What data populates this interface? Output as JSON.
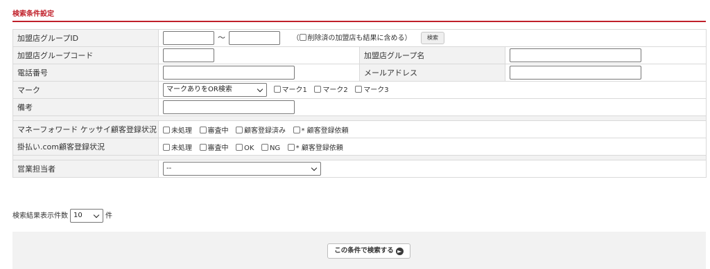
{
  "section_title": "検索条件設定",
  "rows": {
    "group_id": {
      "label": "加盟店グループID",
      "tilde": "～",
      "include_deleted": "削除済の加盟店も結果に含める",
      "paren_open": "（",
      "paren_close": "）",
      "search_button": "検索"
    },
    "group_code": {
      "label": "加盟店グループコード"
    },
    "group_name": {
      "label": "加盟店グループ名"
    },
    "phone": {
      "label": "電話番号"
    },
    "email": {
      "label": "メールアドレス"
    },
    "mark": {
      "label": "マーク",
      "select_value": "マークありをOR検索",
      "options": [
        "マーク1",
        "マーク2",
        "マーク3"
      ]
    },
    "remarks": {
      "label": "備考"
    },
    "mf_status": {
      "label": "マネーフォワード ケッサイ顧客登録状況",
      "options": [
        "未処理",
        "審査中",
        "顧客登録済み",
        "* 顧客登録依頼"
      ]
    },
    "kakebarai_status": {
      "label": "掛払い.com顧客登録状況",
      "options": [
        "未処理",
        "審査中",
        "OK",
        "NG",
        "* 顧客登録依頼"
      ]
    },
    "sales_rep": {
      "label": "営業担当者",
      "select_value": "--"
    }
  },
  "result_count": {
    "label": "検索結果表示件数",
    "value": "10",
    "unit": "件"
  },
  "submit_button": {
    "label": "この条件で検索する"
  }
}
